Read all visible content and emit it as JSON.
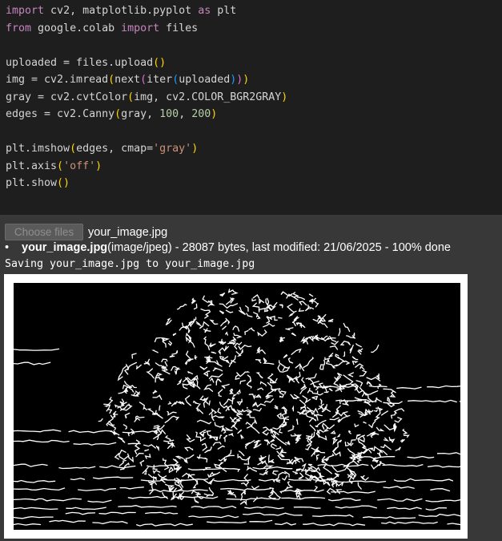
{
  "code_cell": {
    "lines": [
      [
        {
          "t": "import",
          "c": "kw"
        },
        {
          "t": " cv2, matplotlib.pyplot "
        },
        {
          "t": "as",
          "c": "kw"
        },
        {
          "t": " plt"
        }
      ],
      [
        {
          "t": "from",
          "c": "kw"
        },
        {
          "t": " google.colab "
        },
        {
          "t": "import",
          "c": "kw"
        },
        {
          "t": " files"
        }
      ],
      [],
      [
        {
          "t": "uploaded = files.upload"
        },
        {
          "t": "()",
          "c": "p1"
        }
      ],
      [
        {
          "t": "img = cv2.imread"
        },
        {
          "t": "(",
          "c": "p1"
        },
        {
          "t": "next"
        },
        {
          "t": "(",
          "c": "p2"
        },
        {
          "t": "iter"
        },
        {
          "t": "(",
          "c": "p3"
        },
        {
          "t": "uploaded"
        },
        {
          "t": ")",
          "c": "p3"
        },
        {
          "t": ")",
          "c": "p2"
        },
        {
          "t": ")",
          "c": "p1"
        }
      ],
      [
        {
          "t": "gray = cv2.cvtColor"
        },
        {
          "t": "(",
          "c": "p1"
        },
        {
          "t": "img, cv2.COLOR_BGR2GRAY"
        },
        {
          "t": ")",
          "c": "p1"
        }
      ],
      [
        {
          "t": "edges = cv2.Canny"
        },
        {
          "t": "(",
          "c": "p1"
        },
        {
          "t": "gray, "
        },
        {
          "t": "100",
          "c": "num"
        },
        {
          "t": ", "
        },
        {
          "t": "200",
          "c": "num"
        },
        {
          "t": ")",
          "c": "p1"
        }
      ],
      [],
      [
        {
          "t": "plt.imshow"
        },
        {
          "t": "(",
          "c": "p1"
        },
        {
          "t": "edges, cmap="
        },
        {
          "t": "'gray'",
          "c": "str"
        },
        {
          "t": ")",
          "c": "p1"
        }
      ],
      [
        {
          "t": "plt.axis"
        },
        {
          "t": "(",
          "c": "p1"
        },
        {
          "t": "'off'",
          "c": "str"
        },
        {
          "t": ")",
          "c": "p1"
        }
      ],
      [
        {
          "t": "plt.show"
        },
        {
          "t": "()",
          "c": "p1"
        }
      ]
    ]
  },
  "output": {
    "choose_files_label": "Choose files",
    "chosen_file": "your_image.jpg",
    "upload_item": {
      "name": "your_image.jpg",
      "details": "(image/jpeg) - 28087 bytes, last modified: 21/06/2025 - 100% done"
    },
    "saving_text": "Saving your_image.jpg to your_image.jpg"
  },
  "figure": {
    "description_icon": "canny-edge-image",
    "background": "#000000",
    "edge_color": "#ffffff"
  }
}
